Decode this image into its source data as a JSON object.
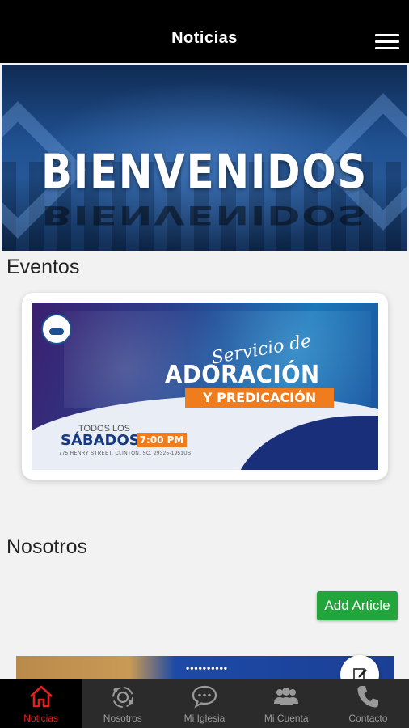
{
  "header": {
    "title": "Noticias",
    "menu_icon": "hamburger-menu-icon"
  },
  "hero": {
    "text": "BIENVENIDOS"
  },
  "sections": {
    "events_title": "Eventos",
    "about_title": "Nosotros"
  },
  "event_flyer": {
    "script_title": "Servicio de",
    "main_title": "ADORACIÓN",
    "subtitle": "Y PREDICACIÓN",
    "days_prefix": "TODOS LOS",
    "day": "SÁBADOS",
    "time": "7:00 PM",
    "address": "775 HENRY STREET, CLINTON, SC, 29325-1951US"
  },
  "actions": {
    "add_article": "Add Article"
  },
  "article_preview": {
    "dots": "••••••••••"
  },
  "tabs": [
    {
      "label": "Noticias",
      "icon": "home-icon",
      "active": true
    },
    {
      "label": "Nosotros",
      "icon": "orbit-icon",
      "active": false
    },
    {
      "label": "Mi Iglesia",
      "icon": "chat-bubble-icon",
      "active": false
    },
    {
      "label": "Mi Cuenta",
      "icon": "users-icon",
      "active": false
    },
    {
      "label": "Contacto",
      "icon": "phone-icon",
      "active": false
    }
  ],
  "colors": {
    "active_tab": "#e3201f",
    "add_button": "#22a53a",
    "topbar": "#000000",
    "tabbar": "#2b2b2b"
  }
}
